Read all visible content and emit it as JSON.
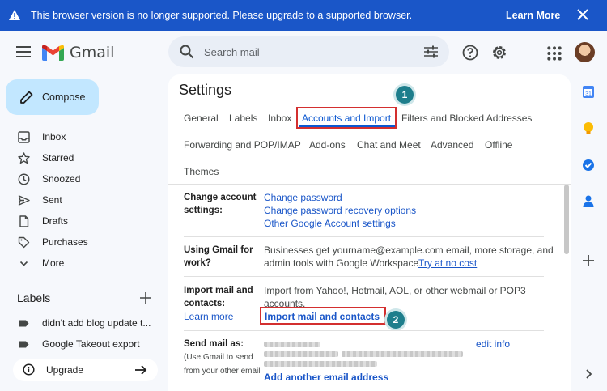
{
  "banner": {
    "message": "This browser version is no longer supported. Please upgrade to a supported browser.",
    "learn_more": "Learn More"
  },
  "header": {
    "logo_text": "Gmail",
    "search_placeholder": "Search mail"
  },
  "compose_label": "Compose",
  "nav": [
    {
      "label": "Inbox",
      "icon": "inbox-icon"
    },
    {
      "label": "Starred",
      "icon": "star-icon"
    },
    {
      "label": "Snoozed",
      "icon": "clock-icon"
    },
    {
      "label": "Sent",
      "icon": "send-icon"
    },
    {
      "label": "Drafts",
      "icon": "draft-icon"
    },
    {
      "label": "Purchases",
      "icon": "tag-icon"
    },
    {
      "label": "More",
      "icon": "chevron-down-icon"
    }
  ],
  "labels": {
    "heading": "Labels",
    "items": [
      "didn't add blog update t...",
      "Google Takeout export"
    ]
  },
  "upgrade_label": "Upgrade",
  "settings": {
    "title": "Settings",
    "tabs_row1": [
      "General",
      "Labels",
      "Inbox",
      "Accounts and Import",
      "Filters and Blocked Addresses"
    ],
    "tabs_row2": [
      "Forwarding and POP/IMAP",
      "Add-ons",
      "Chat and Meet",
      "Advanced",
      "Offline"
    ],
    "tabs_row3": [
      "Themes"
    ],
    "active_tab": "Accounts and Import",
    "step1": "1",
    "step2": "2",
    "sections": {
      "change_account": {
        "label_l1": "Change account",
        "label_l2": "settings:",
        "links": [
          "Change password",
          "Change password recovery options",
          "Other Google Account settings"
        ]
      },
      "work": {
        "label_l1": "Using Gmail for",
        "label_l2": "work?",
        "text_l1": "Businesses get yourname@example.com email, more storage, and",
        "text_l2": "admin tools with Google Workspace.",
        "link": "Try at no cost"
      },
      "import": {
        "label_l1": "Import mail and",
        "label_l2": "contacts:",
        "learn_more": "Learn more",
        "text_l1": "Import from Yahoo!, Hotmail, AOL, or other webmail or POP3",
        "text_l2": "accounts.",
        "action": "Import mail and contacts"
      },
      "send_as": {
        "label": "Send mail as:",
        "sub_l1": "(Use Gmail to send",
        "sub_l2": "from your other email",
        "edit": "edit info",
        "add": "Add another email address"
      }
    }
  },
  "colors": {
    "banner": "#1a56c8",
    "accent": "#0b57d0",
    "highlight": "#d32f2f",
    "step_badge": "#1e7e8c"
  }
}
